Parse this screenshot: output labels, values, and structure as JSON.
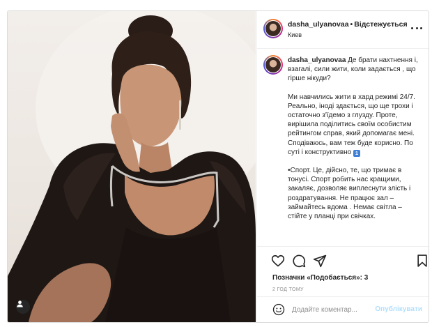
{
  "header": {
    "username": "dasha_ulyanovaa",
    "separator": "•",
    "follow_label": "Відстежується",
    "location": "Киев"
  },
  "caption": {
    "username": "dasha_ulyanovaa",
    "paragraph1": "Де брати нахтнення і, взагалі, сили жити, коли задається , що гірше нікуди?",
    "paragraph2": "Ми навчились жити в хард режимі 24/7. Реально, іноді здається, що ще трохи і остаточно з'їдемо з глузду. Проте, вирішила поділитись своїм особистим рейтингом справ, який допомагає мені. Сподіваюсь, вам теж буде корисно. По суті і конструктивно",
    "badge": "1",
    "paragraph3": "•Спорт. Це, дійсно, те, що тримає в тонусі. Спорт робить нас кращими, закаляє, дозволяє виплеснути злість і роздратування. Не працює зал – займайтесь вдома . Немає світла – стійте у планці при свічках."
  },
  "likes": "Позначки «Подобається»: 3",
  "timestamp": "2 ГОД ТОМУ",
  "add_comment": {
    "placeholder": "Додайте коментар...",
    "post_label": "Опублікувати"
  },
  "icons": {
    "like": "heart-icon",
    "comment": "comment-icon",
    "share": "share-icon",
    "save": "bookmark-icon",
    "more": "more-icon",
    "emoji": "emoji-icon",
    "tag": "user-tag-icon"
  },
  "colors": {
    "text": "#262626",
    "muted": "#8e8e8e",
    "border": "#dbdbdb",
    "post_button": "#b2dffc"
  }
}
